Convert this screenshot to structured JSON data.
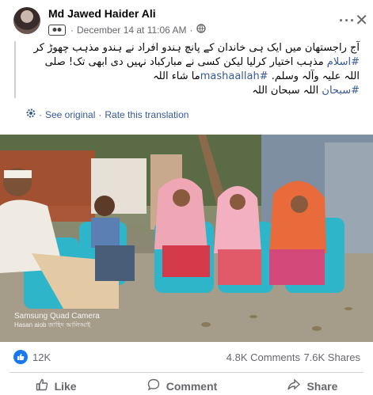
{
  "post": {
    "author": "Md Jawed Haider Ali",
    "date": "December 14 at 11:06 AM",
    "separator": "·",
    "text_line1": "آج راجستھان میں ایک ہی خاندان کے پانچ ہندو افراد نے ہندو مذہب چھوڑ کر",
    "text_line2_pre": "#اسلام",
    "text_line2_post": " مذہب اختیار کرلیا لیکن کسی نے مبارکباد نہیں دی ابھی تک! صلی",
    "text_line3_pre": "اللہ علیہ وآلہ وسلم. ",
    "text_line3_hash": "#mashaallah",
    "text_line3_post": "ما شاء اللہ",
    "text_line4_hash": "#سبحان",
    "text_line4_post": " اللہ سبحان اللہ"
  },
  "translation": {
    "see_original": "See original",
    "rate": "Rate this translation",
    "dot": "·"
  },
  "photo": {
    "watermark": "Samsung Quad Camera",
    "watermark_sub": "Hasan aiob জাহিদ আলিআই"
  },
  "stats": {
    "likes": "12K",
    "comments": "4.8K Comments",
    "shares": "7.6K Shares"
  },
  "actions": {
    "like": "Like",
    "comment": "Comment",
    "share": "Share"
  },
  "icons": {
    "globe": "globe-icon",
    "like": "thumbs-up-icon"
  }
}
